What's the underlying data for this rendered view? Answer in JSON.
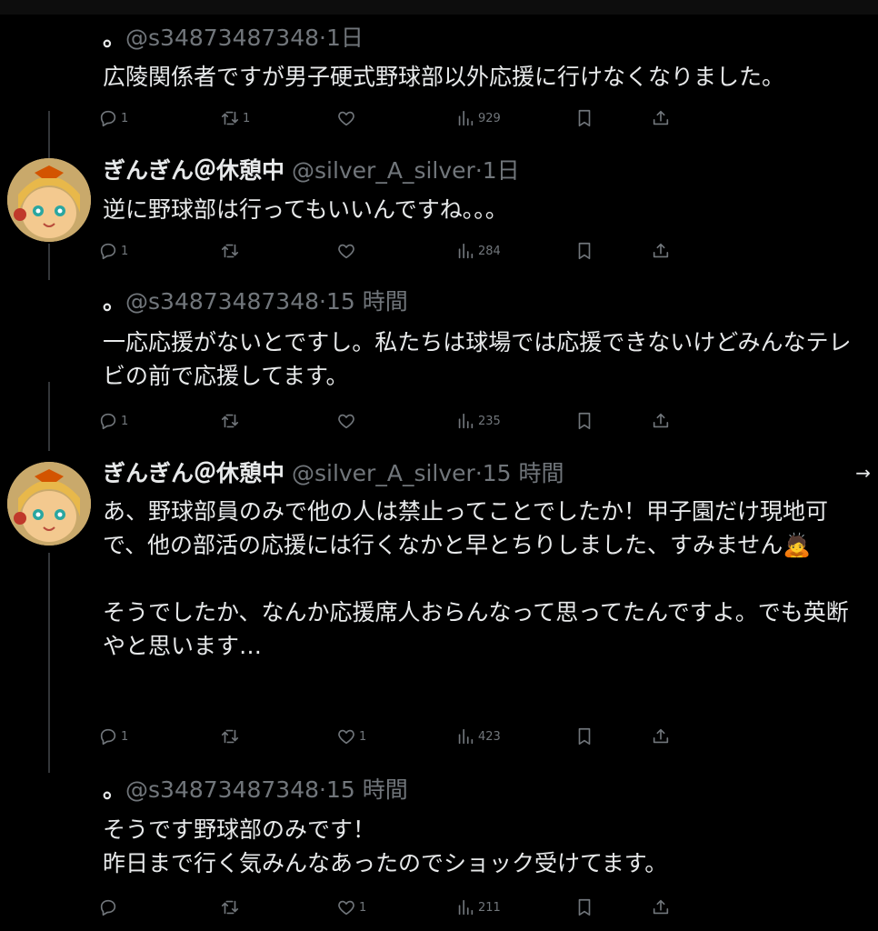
{
  "colors": {
    "background": "#000000",
    "text_primary": "#e7e9ea",
    "text_secondary": "#71767b",
    "thread_line": "#333639"
  },
  "tweets": [
    {
      "prefix": "。",
      "name": "",
      "handle": "@s34873487348",
      "time": "·1日",
      "text": "広陵関係者ですが男子硬式野球部以外応援に行けなくなりました。",
      "replies": "1",
      "retweets": "1",
      "likes": "",
      "views": "929"
    },
    {
      "prefix": "",
      "name": "ぎんぎん＠休憩中",
      "handle": "@silver_A_silver",
      "time": "·1日",
      "text": "逆に野球部は行ってもいいんですね。。。",
      "replies": "1",
      "retweets": "",
      "likes": "",
      "views": "284"
    },
    {
      "prefix": "。",
      "name": "",
      "handle": "@s34873487348",
      "time": "·15 時間",
      "text": "一応応援がないとですし。私たちは球場では応援できないけどみんなテレビの前で応援してます。",
      "replies": "1",
      "retweets": "",
      "likes": "",
      "views": "235"
    },
    {
      "prefix": "",
      "name": "ぎんぎん＠休憩中",
      "handle": "@silver_A_silver",
      "time": "·15 時間",
      "text": "あ、野球部員のみで他の人は禁止ってことでしたか！甲子園だけ現地可で、他の部活の応援には行くなかと早とちりしました、すみません🙇\n\nそうでしたか、なんか応援席人おらんなって思ってたんですよ。でも英断やと思います…",
      "replies": "1",
      "retweets": "",
      "likes": "1",
      "views": "423",
      "more_arrow": "→"
    },
    {
      "prefix": "。",
      "name": "",
      "handle": "@s34873487348",
      "time": "·15 時間",
      "text": "そうです野球部のみです！\n昨日まで行く気みんなあったのでショック受けてます。",
      "replies": "",
      "retweets": "",
      "likes": "1",
      "views": "211"
    }
  ],
  "icons": {
    "reply": "reply-icon",
    "retweet": "retweet-icon",
    "like": "heart-icon",
    "views": "views-icon",
    "bookmark": "bookmark-icon",
    "share": "share-icon",
    "avatar": "avatar-image"
  }
}
